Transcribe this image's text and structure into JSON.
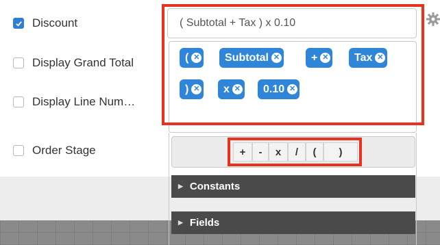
{
  "options": [
    {
      "label": "Discount",
      "checked": true
    },
    {
      "label": "Display Grand Total",
      "checked": false
    },
    {
      "label": "Display Line Num…",
      "checked": false
    },
    {
      "label": "Order Stage",
      "checked": false
    }
  ],
  "formula": {
    "value": "( Subtotal + Tax ) x 0.10",
    "tokens": [
      "(",
      "Subtotal",
      "+",
      "Tax",
      ")",
      "x",
      "0.10"
    ]
  },
  "operators": [
    "+",
    "-",
    "x",
    "/",
    "(",
    ")"
  ],
  "sections": [
    {
      "label": "Constants",
      "icon": "caret-right-icon"
    },
    {
      "label": "Fields",
      "icon": "caret-right-icon"
    }
  ],
  "colors": {
    "accent": "#2f86d9",
    "highlight": "#e8321f",
    "section_bg": "#4a4a4a"
  },
  "icons": {
    "settings": "gear-icon",
    "remove_token": "close-icon",
    "checkbox_checked": "check-icon"
  }
}
